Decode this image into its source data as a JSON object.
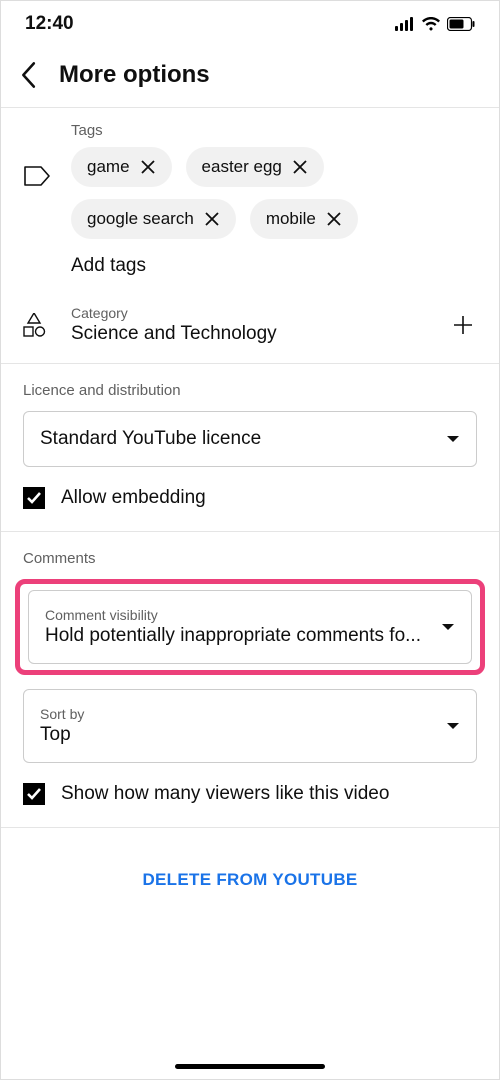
{
  "status": {
    "time": "12:40"
  },
  "header": {
    "title": "More options"
  },
  "tags": {
    "label": "Tags",
    "items": [
      {
        "label": "game"
      },
      {
        "label": "easter egg"
      },
      {
        "label": "google search"
      },
      {
        "label": "mobile"
      }
    ],
    "add_label": "Add tags"
  },
  "category": {
    "label": "Category",
    "value": "Science and Technology"
  },
  "licence": {
    "section_title": "Licence and distribution",
    "licence_value": "Standard YouTube licence",
    "allow_embedding_label": "Allow embedding"
  },
  "comments": {
    "section_title": "Comments",
    "visibility_label": "Comment visibility",
    "visibility_value": "Hold potentially inappropriate comments fo...",
    "sort_label": "Sort by",
    "sort_value": "Top",
    "show_likes_label": "Show how many viewers like this video"
  },
  "delete": {
    "label": "DELETE FROM YOUTUBE"
  }
}
